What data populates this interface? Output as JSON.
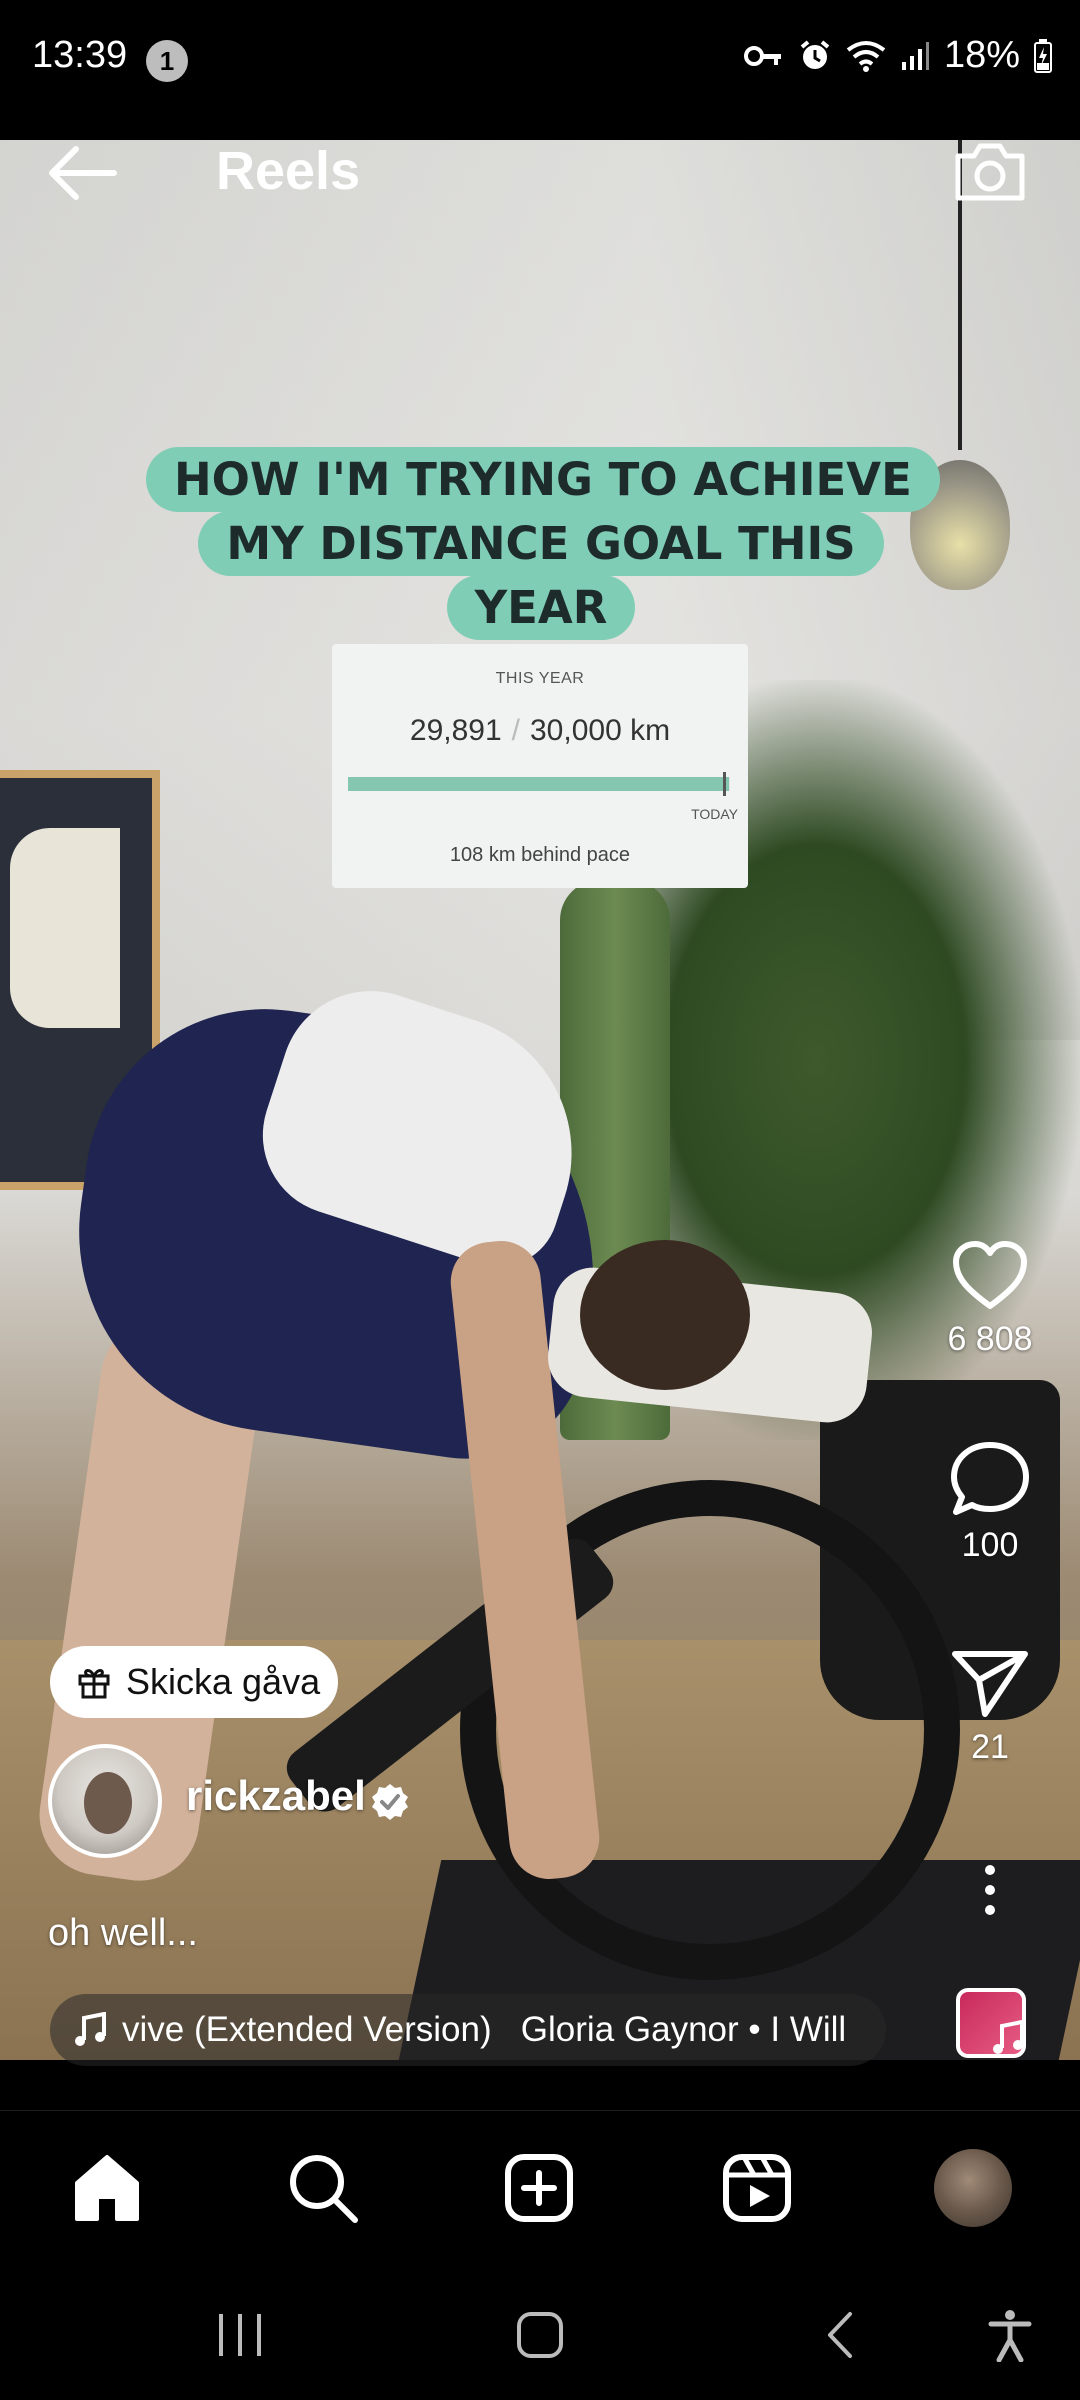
{
  "status_bar": {
    "time": "13:39",
    "notification_count": "1",
    "battery": "18%",
    "icons": [
      "vpn-key-icon",
      "alarm-icon",
      "wifi-icon",
      "signal-icon",
      "battery-charging-icon"
    ]
  },
  "header": {
    "title": "Reels",
    "back_icon": "arrow-left-icon",
    "camera_icon": "camera-icon"
  },
  "video_overlay": {
    "headline": "HOW I'M TRYING TO ACHIEVE MY DISTANCE GOAL THIS YEAR",
    "stats_card": {
      "label": "THIS YEAR",
      "current": "29,891",
      "separator": "/",
      "goal": "30,000 km",
      "progress_fraction": 0.9964,
      "today_label": "TODAY",
      "pace": "108 km behind pace"
    }
  },
  "actions": {
    "likes": "6 808",
    "comments": "100",
    "shares": "21"
  },
  "gift": {
    "label": "Skicka gåva"
  },
  "author": {
    "username": "rickzabel",
    "verified": true,
    "caption": "oh well..."
  },
  "music": {
    "text": "vive (Extended Version)   Gloria Gaynor • I Will"
  },
  "bottom_nav": {
    "items": [
      "home-icon",
      "search-icon",
      "create-icon",
      "reels-icon",
      "profile-avatar"
    ]
  },
  "system_nav": {
    "items": [
      "recents-icon",
      "home-icon",
      "back-icon",
      "accessibility-icon"
    ]
  },
  "colors": {
    "headline_bg": "#80cdb5",
    "progress": "#84c6b0",
    "background": "#000000"
  }
}
